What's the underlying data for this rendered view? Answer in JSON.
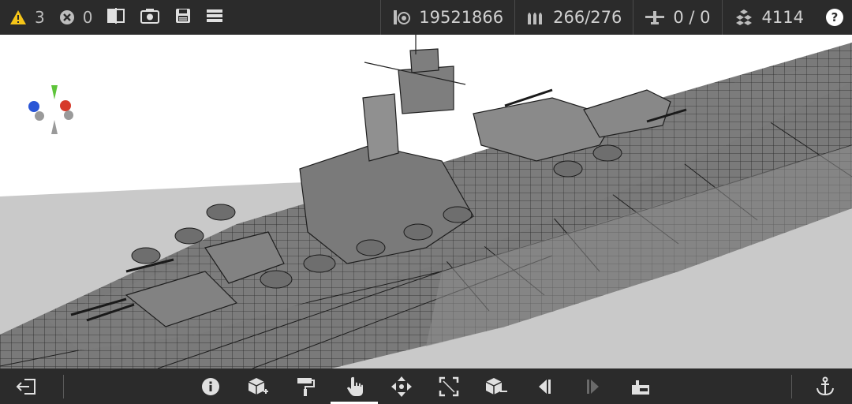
{
  "topbar": {
    "warnings": {
      "count": "3",
      "icon": "warning-icon",
      "color": "#f5c518"
    },
    "errors": {
      "count": "0",
      "icon": "error-icon"
    },
    "tools": [
      {
        "icon": "split-view-icon"
      },
      {
        "icon": "screenshot-camera-icon"
      },
      {
        "icon": "save-icon"
      },
      {
        "icon": "menu-icon"
      }
    ],
    "stats": [
      {
        "icon": "cost-icon",
        "value": "19521866"
      },
      {
        "icon": "ammunition-icon",
        "value": "266/276"
      },
      {
        "icon": "aircraft-icon",
        "value": "0 / 0"
      },
      {
        "icon": "parts-icon",
        "value": "4114"
      }
    ],
    "help_label": "?"
  },
  "toolbar": {
    "left": {
      "icon": "exit-icon"
    },
    "tools": [
      {
        "icon": "info-icon"
      },
      {
        "icon": "add-block-icon"
      },
      {
        "icon": "paint-roller-icon"
      },
      {
        "icon": "hand-select-icon",
        "active": true
      },
      {
        "icon": "move-arrows-icon"
      },
      {
        "icon": "resize-icon"
      },
      {
        "icon": "remove-block-icon"
      },
      {
        "icon": "previous-icon"
      },
      {
        "icon": "next-icon",
        "disabled": true
      },
      {
        "icon": "factory-icon"
      }
    ],
    "right": {
      "icon": "anchor-icon"
    }
  },
  "gizmo": {
    "x_color": "#d63a2a",
    "y_color": "#5ec43a",
    "z_color": "#2a56d6",
    "neg_color": "#9a9a9a"
  },
  "colors": {
    "hull": "#8a8a8a",
    "deck": "#7c7c7c",
    "water": "#c9c9c9",
    "bars": "#2b2b2b"
  }
}
